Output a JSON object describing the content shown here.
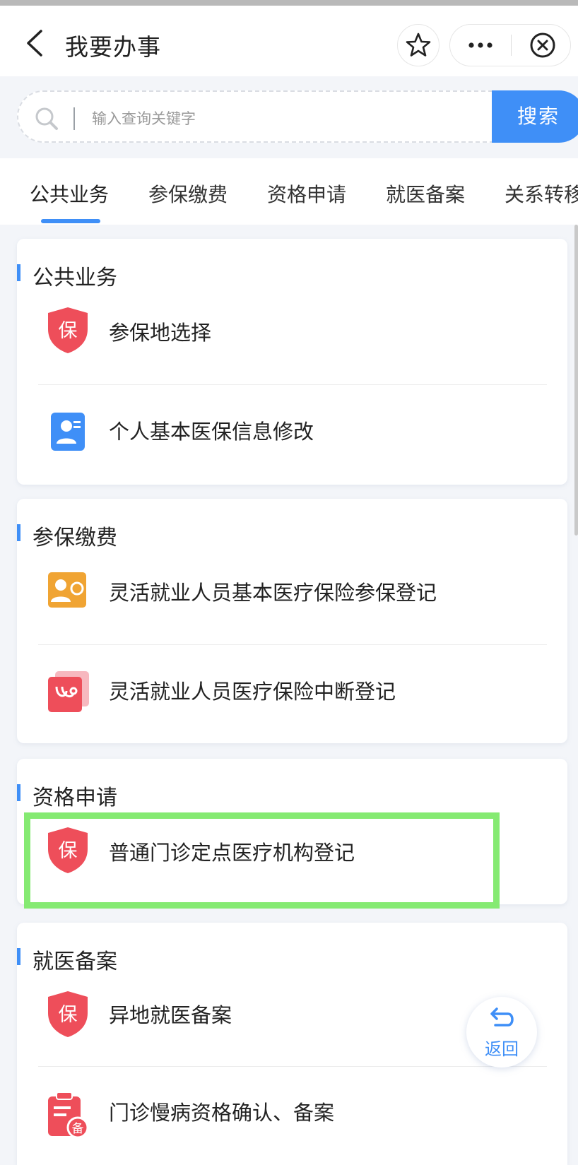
{
  "header": {
    "title": "我要办事"
  },
  "search": {
    "placeholder": "输入查询关键字",
    "button_label": "搜索"
  },
  "tabs": [
    {
      "label": "公共业务",
      "active": true
    },
    {
      "label": "参保缴费",
      "active": false
    },
    {
      "label": "资格申请",
      "active": false
    },
    {
      "label": "就医备案",
      "active": false
    },
    {
      "label": "关系转移",
      "active": false
    }
  ],
  "sections": [
    {
      "title": "公共业务",
      "items": [
        {
          "label": "参保地选择",
          "icon": "shield-bao-icon"
        },
        {
          "label": "个人基本医保信息修改",
          "icon": "id-card-icon"
        }
      ]
    },
    {
      "title": "参保缴费",
      "items": [
        {
          "label": "灵活就业人员基本医疗保险参保登记",
          "icon": "person-register-icon"
        },
        {
          "label": "灵活就业人员医疗保险中断登记",
          "icon": "stethoscope-icon"
        }
      ]
    },
    {
      "title": "资格申请",
      "items": [
        {
          "label": "普通门诊定点医疗机构登记",
          "icon": "shield-bao-icon"
        }
      ]
    },
    {
      "title": "就医备案",
      "items": [
        {
          "label": "异地就医备案",
          "icon": "shield-bao-icon"
        },
        {
          "label": "门诊慢病资格确认、备案",
          "icon": "clipboard-bei-icon"
        }
      ]
    }
  ],
  "float_button": {
    "label": "返回"
  },
  "colors": {
    "accent": "#3f8ff7",
    "shield_red": "#ee4e5a",
    "highlight": "#85ea72"
  }
}
